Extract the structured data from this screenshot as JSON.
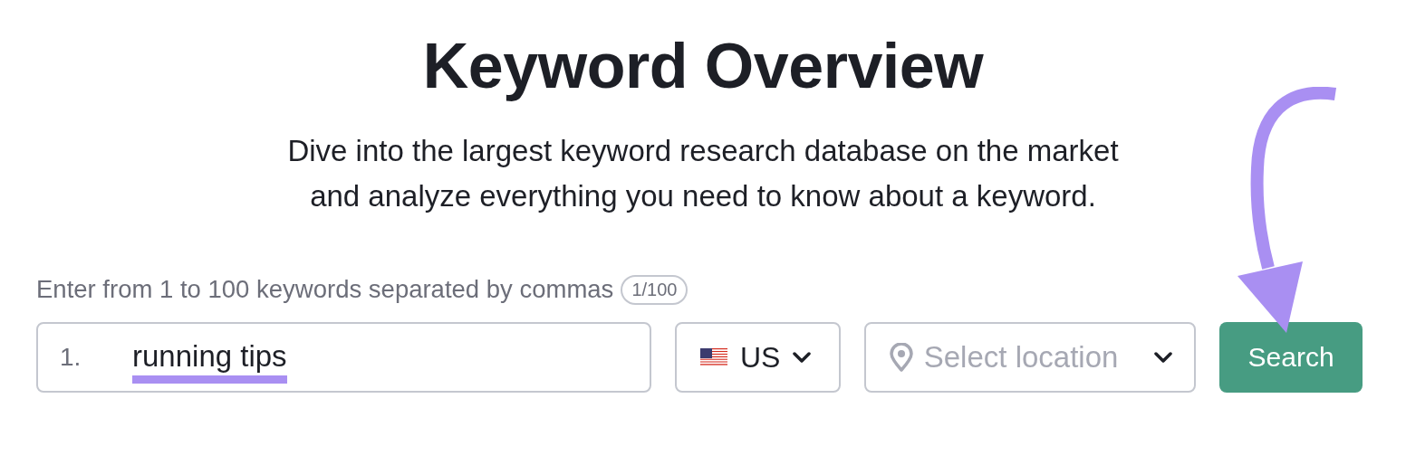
{
  "title": "Keyword Overview",
  "subtitle_lines": [
    "Dive into the largest keyword research database on the market",
    "and analyze everything you need to know about a keyword."
  ],
  "keywords_label": "Enter from 1 to 100 keywords separated by commas",
  "keywords_count": "1/100",
  "keyword_field": {
    "line_number": "1.",
    "value": "running tips",
    "underlined": true
  },
  "country_select": {
    "value": "US"
  },
  "location_select": {
    "placeholder": "Select location"
  },
  "search_button": {
    "label": "Search"
  },
  "annotation_arrow": true
}
